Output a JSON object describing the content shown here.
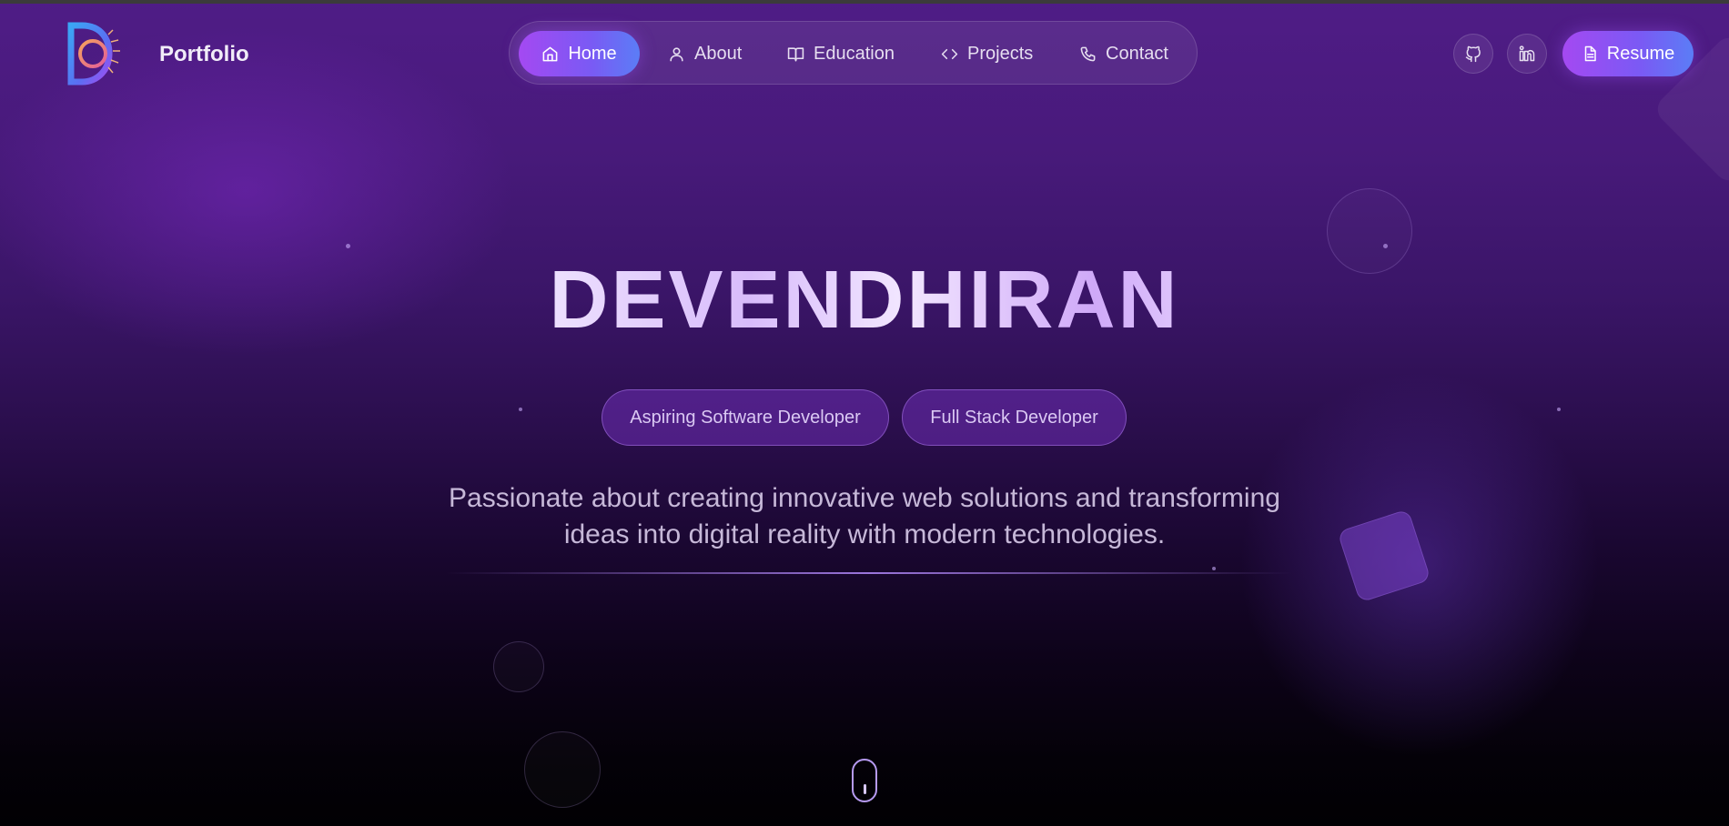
{
  "navbar": {
    "brand": "Portfolio",
    "items": [
      {
        "label": "Home",
        "icon": "home-icon",
        "active": true
      },
      {
        "label": "About",
        "icon": "user-icon",
        "active": false
      },
      {
        "label": "Education",
        "icon": "book-icon",
        "active": false
      },
      {
        "label": "Projects",
        "icon": "code-icon",
        "active": false
      },
      {
        "label": "Contact",
        "icon": "phone-icon",
        "active": false
      }
    ],
    "social": [
      {
        "icon": "github-icon"
      },
      {
        "icon": "linkedin-icon"
      }
    ],
    "resume_label": "Resume"
  },
  "hero": {
    "name": "DEVENDHIRAN",
    "chips": [
      "Aspiring Software Developer",
      "Full Stack Developer"
    ],
    "tagline_line1": "Passionate about creating innovative web solutions and transforming",
    "tagline_line2": "ideas into digital reality with modern technologies."
  },
  "colors": {
    "accent_start": "#a449f2",
    "accent_end": "#5b7df6",
    "background_top": "#4f1c86",
    "background_bottom": "#010003"
  }
}
